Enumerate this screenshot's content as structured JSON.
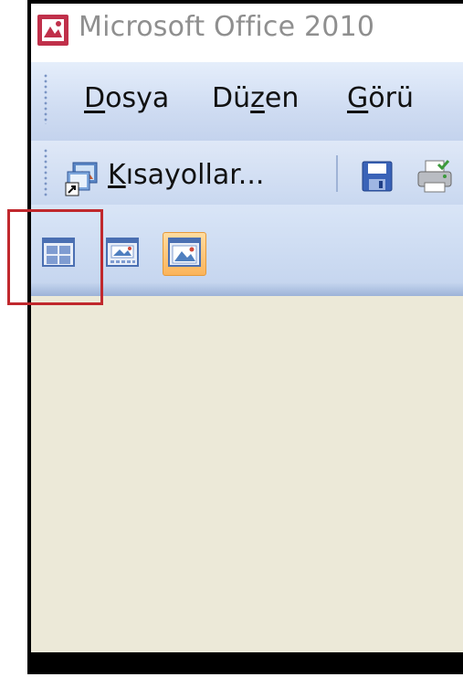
{
  "window": {
    "title": "Microsoft Office 2010"
  },
  "menubar": {
    "items": [
      {
        "pre": "",
        "key": "D",
        "post": "osya"
      },
      {
        "pre": "Dü",
        "key": "z",
        "post": "en"
      },
      {
        "pre": "",
        "key": "G",
        "post": "örü"
      }
    ]
  },
  "toolbar": {
    "shortcuts": {
      "pre": "",
      "key": "K",
      "post": "ısayollar..."
    }
  },
  "view_buttons": [
    {
      "name": "thumbnail-view-icon",
      "active": false
    },
    {
      "name": "filmstrip-view-icon",
      "active": false
    },
    {
      "name": "single-image-view-icon",
      "active": true
    }
  ],
  "colors": {
    "highlight": "#c0282d",
    "active_button": "#fbb45a",
    "content_bg": "#ece9d8",
    "toolbar_bg": "#cfdcf2"
  }
}
